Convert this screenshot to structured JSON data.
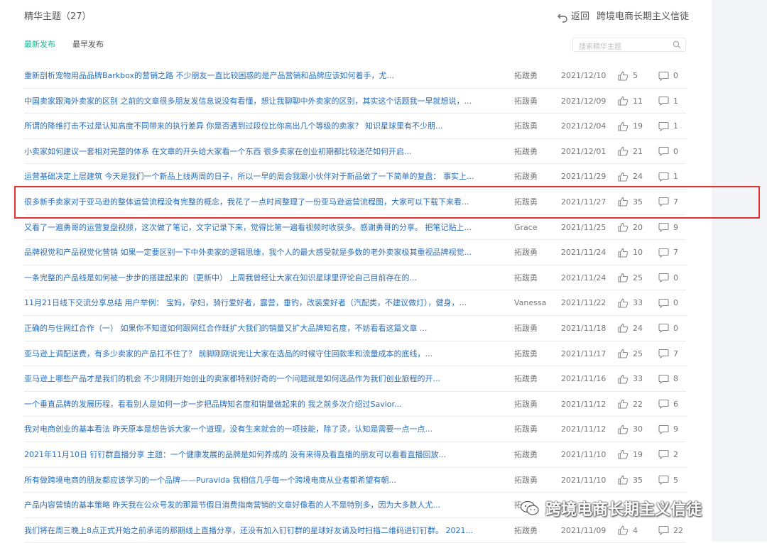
{
  "header": {
    "title": "精华主题（27）",
    "back_label": "返回",
    "group_name": "跨境电商长期主义信徒"
  },
  "tabs": [
    {
      "label": "最新发布",
      "active": true
    },
    {
      "label": "最早发布",
      "active": false
    }
  ],
  "search": {
    "placeholder": "搜索精华主题"
  },
  "accent_color": "#16b998",
  "link_color": "#2a6ebb",
  "highlight_color": "#e0332f",
  "topics": [
    {
      "text": "重新剖析宠物用品品牌Barkbox的营销之路 不少朋友一直比较困惑的是产品营销和品牌应该如何着手，尤...",
      "author": "拓跋勇",
      "date": "2021/12/10",
      "likes": "5",
      "comments": "0"
    },
    {
      "text": "中国卖家跟海外卖家的区别 之前的文章很多朋友发信息说没有看懂，想让我聊聊中外卖家的区别，其实这个话题我一早就想说，...",
      "author": "拓跋勇",
      "date": "2021/12/09",
      "likes": "11",
      "comments": "1"
    },
    {
      "text": "所谓的降维打击不过是认知高度不同带来的执行差异 你是否遇到过段位比你高出几个等级的卖家？ 知识星球里有不少朋...",
      "author": "拓跋勇",
      "date": "2021/12/04",
      "likes": "19",
      "comments": "1"
    },
    {
      "text": "小卖家如何建议一套相对完整的体系 在文章的开头给大家看一个东西 很多卖家在创业初期都比较迷茫如何开启...",
      "author": "拓跋勇",
      "date": "2021/12/01",
      "likes": "21",
      "comments": "0"
    },
    {
      "text": "运营基础决定上层建筑 今天是我们一个新品上线两周的日子，所以一早的周会我跟小伙伴对于新品做了一下简单的复盘： 事实上...",
      "author": "拓跋勇",
      "date": "2021/11/29",
      "likes": "24",
      "comments": "1"
    },
    {
      "text": "很多新手卖家对于亚马逊的整体运营流程没有完整的概念，我花了一点时间整理了一份亚马逊运营流程图，大家可以下载下来看...",
      "author": "拓跋勇",
      "date": "2021/11/27",
      "likes": "35",
      "comments": "7"
    },
    {
      "text": "又看了一遍勇哥的运营复盘视频，这次做了笔记，文字记录下来，觉得比第一遍看视频时收获多。感谢勇哥的分享。 把笔记贴上...",
      "author": "Grace",
      "date": "2021/11/25",
      "likes": "20",
      "comments": "9"
    },
    {
      "text": "品牌视觉和产品视觉化营销 如果一定要区别一下中外卖家的逻辑思维，我个人的最大感受就是多数的老外卖家极其重视品牌视觉...",
      "author": "拓跋勇",
      "date": "2021/11/24",
      "likes": "10",
      "comments": "7"
    },
    {
      "text": "一条完整的产品线是如何被一步步的搭建起来的（更新中） 上周我曾经让大家在知识星球里评论自己目前存在的...",
      "author": "拓跋勇",
      "date": "2021/11/24",
      "likes": "25",
      "comments": "0"
    },
    {
      "text": "11月21日线下交流分享总结 用户举例： 宝妈，孕妇，骑行爱好者，露营，垂钓，改装爱好者（汽配类，不建议做灯），健身，...",
      "author": "Vanessa",
      "date": "2021/11/22",
      "likes": "33",
      "comments": "0"
    },
    {
      "text": "正确的与住网红合作（一） 如果你不知道如何跟网红合作既扩大我们的销量又扩大品牌知名度，不妨看看这篇文章 ...",
      "author": "拓跋勇",
      "date": "2021/11/18",
      "likes": "24",
      "comments": "0"
    },
    {
      "text": "亚马逊上调配送费，有多少卖家的产品扛不住了？ 前脚刚刚说完让大家在选品的时候守住回款率和流量成本的底线，...",
      "author": "拓跋勇",
      "date": "2021/11/17",
      "likes": "25",
      "comments": "7"
    },
    {
      "text": "亚马逊上哪些产品才是我们的机会 不少刚刚开始创业的卖家都特别好奇的一个问题就是如何选品作为我们创业旅程的开...",
      "author": "拓跋勇",
      "date": "2021/11/16",
      "likes": "33",
      "comments": "8"
    },
    {
      "text": "一个垂直品牌的发展历程，看看别人是如何一步一步把品牌知名度和销量做起来的 我之前多次介绍过Savior...",
      "author": "拓跋勇",
      "date": "2021/11/12",
      "likes": "22",
      "comments": "6"
    },
    {
      "text": "我对电商创业的基本看法 昨天原本是想告诉大家一个道理，没有生来就会的一项技能，除了烫，认知是需要一点一点...",
      "author": "拓跋勇",
      "date": "2021/11/12",
      "likes": "30",
      "comments": "9"
    },
    {
      "text": "2021年11月10日 钉钉群直播分享 主题：一个健康发展的品牌是如何养成的 没有来得及看直播的朋友可以看看直播回放...",
      "author": "拓跋勇",
      "date": "2021/11/10",
      "likes": "19",
      "comments": "2"
    },
    {
      "text": "所有做跨境电商的朋友都应该学习的一个品牌——Puravida 我相信几乎每一个跨境电商从业者都希望有朝...",
      "author": "拓跋勇",
      "date": "2021/11/10",
      "likes": "35",
      "comments": "5"
    },
    {
      "text": "产品内容营销的基本策略 昨天我在公众号发的那篇节假日消费指南营销的文章好像看的人不是特别多，因为大多数人尤...",
      "author": "拓",
      "date": "",
      "likes": "",
      "comments": ""
    },
    {
      "text": "我们将在周三晚上8点正式开始之前承诺的那期线上直播分享，还没有加入钉钉群的星球好友请及时扫描二维码进钉钉群。 2021...",
      "author": "拓跋勇",
      "date": "2021/11/09",
      "likes": "4",
      "comments": "22"
    }
  ],
  "watermark": {
    "text": "跨境电商长期主义信徒",
    "icon": "wechat-icon"
  }
}
